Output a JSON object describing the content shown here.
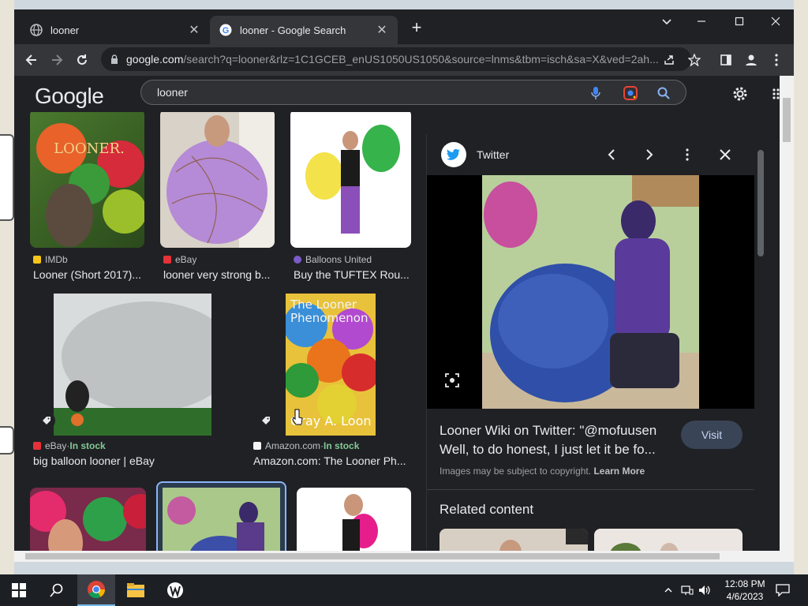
{
  "browser": {
    "tabs": [
      {
        "title": "looner",
        "active": false
      },
      {
        "title": "looner - Google Search",
        "active": true
      }
    ],
    "address": {
      "host": "google.com",
      "path": "/search?q=looner&rlz=1C1GCEB_enUS1050US1050&source=lnms&tbm=isch&sa=X&ved=2ah..."
    }
  },
  "search": {
    "logo": "Google",
    "query": "looner"
  },
  "results": [
    {
      "source": "IMDb",
      "title": "Looner (Short 2017)...",
      "stock": ""
    },
    {
      "source": "eBay",
      "title": "looner very strong b...",
      "stock": ""
    },
    {
      "source": "Balloons United",
      "title": "Buy the TUFTEX Rou...",
      "stock": ""
    },
    {
      "source": "eBay",
      "title": "big balloon looner | eBay",
      "stock": "In stock"
    },
    {
      "source": "Amazon.com",
      "title": "Amazon.com: The Looner Ph...",
      "stock": "In stock"
    }
  ],
  "book_cover": {
    "title": "The Looner Phenomenon",
    "author": "Gray A. Loon",
    "cover_text": "LOONER."
  },
  "panel": {
    "site": "Twitter",
    "title": "Looner Wiki on Twitter: \"@mofuusen Well, to do honest, I just let it be fo...",
    "visit": "Visit",
    "copyright": "Images may be subject to copyright.",
    "learn_more": "Learn More",
    "related": "Related content"
  },
  "taskbar": {
    "time": "12:08 PM",
    "date": "4/6/2023"
  },
  "stock_separator": " · "
}
